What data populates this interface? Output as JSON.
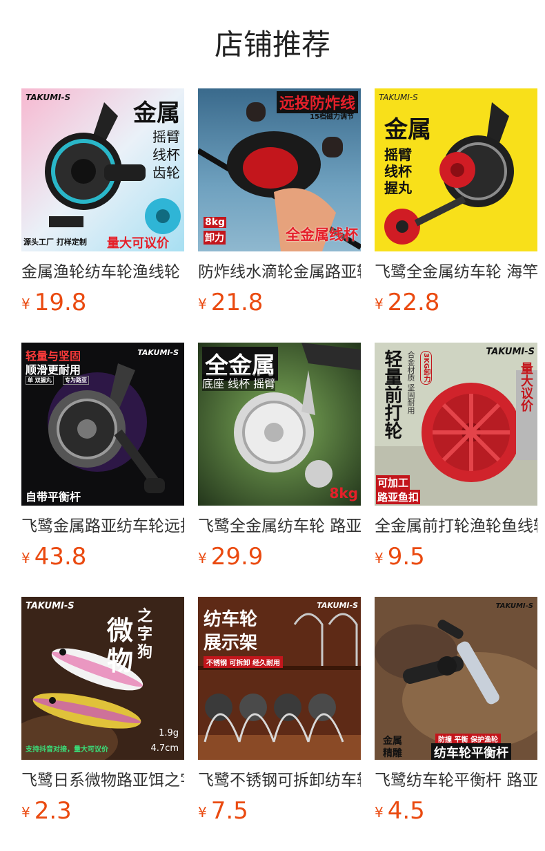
{
  "page": {
    "title": "店铺推荐",
    "currency": "¥"
  },
  "colors": {
    "price": "#ea4a10",
    "title": "#222222",
    "name": "#333333"
  },
  "products": [
    {
      "name": "金属渔轮纺车轮渔线轮",
      "price": "19.8",
      "image": {
        "brand": "TAKUMI-S",
        "headline": "金属",
        "lines": [
          "摇臂",
          "线杯",
          "齿轮"
        ],
        "footer_left": "源头工厂  打样定制",
        "footer_right": "量大可议价"
      }
    },
    {
      "name": "防炸线水滴轮金属路亚轮",
      "price": "21.8",
      "image": {
        "headline": "远投防炸线",
        "sub": "15档磁力调节",
        "badge": [
          "8kg",
          "卸力"
        ],
        "footer_right": "全金属线杯"
      }
    },
    {
      "name": "飞鹭全金属纺车轮 海竿",
      "price": "22.8",
      "image": {
        "brand": "TAKUMI-S",
        "headline": "金属",
        "lines": [
          "摇臂",
          "线杯",
          "握丸"
        ]
      }
    },
    {
      "name": "飞鹭金属路亚纺车轮远投",
      "price": "43.8",
      "image": {
        "brand": "TAKUMI-S",
        "headline": "轻量与坚固",
        "sub": "顺滑更耐用",
        "tags": [
          "单 双握丸",
          "专为路亚"
        ],
        "footer_left": "自带平衡杆"
      }
    },
    {
      "name": "飞鹭全金属纺车轮 路亚轮",
      "price": "29.9",
      "image": {
        "headline": "全金属",
        "sub": "底座 线杯 摇臂",
        "footer_right": "8kg"
      }
    },
    {
      "name": "全金属前打轮渔轮鱼线轮",
      "price": "9.5",
      "image": {
        "brand": "TAKUMI-S",
        "headline": "轻量前打轮",
        "sub": "合金材质 坚固耐用",
        "pill": "3KG卸力",
        "side": "量大议价",
        "footer_left": [
          "可加工",
          "路亚鱼扣"
        ]
      }
    },
    {
      "name": "飞鹭日系微物路亚饵之字狗",
      "price": "2.3",
      "image": {
        "brand": "TAKUMI-S",
        "headline": [
          "微",
          "物"
        ],
        "sub": [
          "之",
          "字",
          "狗"
        ],
        "specs": [
          "1.9g",
          "4.7cm"
        ],
        "footer_left": "支持抖音对接，量大可议价"
      }
    },
    {
      "name": "飞鹭不锈钢可拆卸纺车轮展示架",
      "price": "7.5",
      "image": {
        "brand": "TAKUMI-S",
        "headline": [
          "纺车轮",
          "展示架"
        ],
        "sub": "不锈钢 可拆卸 经久耐用"
      }
    },
    {
      "name": "飞鹭纺车轮平衡杆 路亚",
      "price": "4.5",
      "image": {
        "brand": "TAKUMI-S",
        "tag": [
          "金属",
          "精雕"
        ],
        "sub": "防撞  平衡  保护渔轮",
        "footer_right": "纺车轮平衡杆"
      }
    }
  ]
}
